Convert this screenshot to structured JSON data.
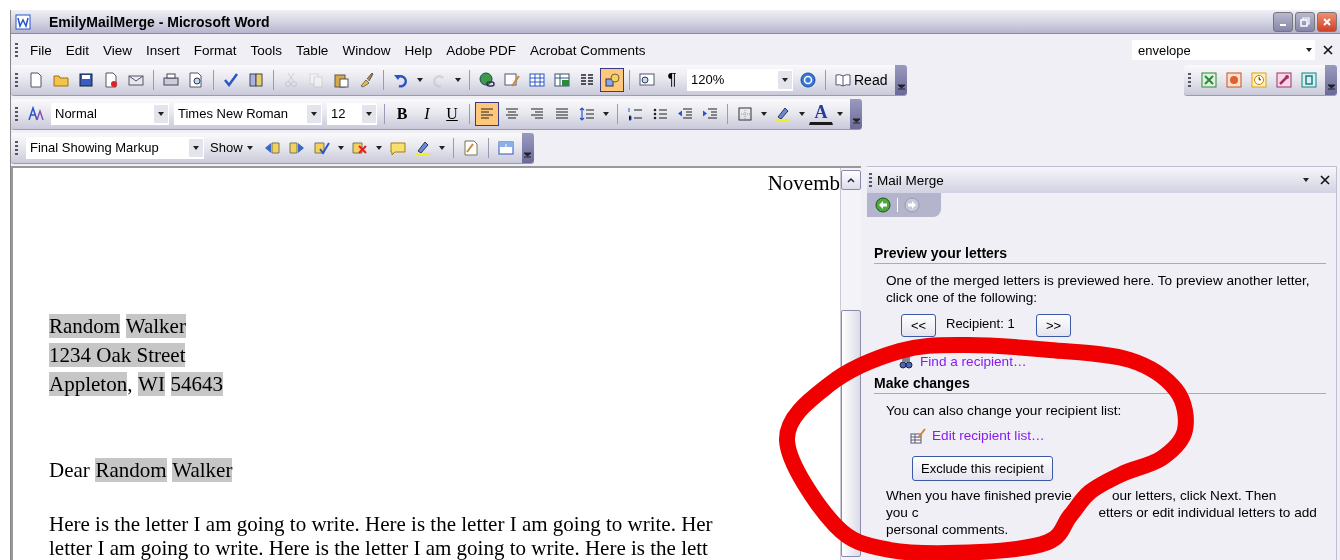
{
  "window": {
    "title": "EmilyMailMerge - Microsoft Word"
  },
  "menu_bar": {
    "items": [
      "File",
      "Edit",
      "View",
      "Insert",
      "Format",
      "Tools",
      "Table",
      "Window",
      "Help",
      "Adobe PDF",
      "Acrobat Comments"
    ],
    "help_box": {
      "value": "envelope"
    }
  },
  "standard_toolbar": {
    "drawing_on": true,
    "show_marks_label": "¶",
    "zoom": "120%",
    "read_label": "Read"
  },
  "formatting_toolbar": {
    "style": "Normal",
    "font": "Times New Roman",
    "size": "12",
    "text_buttons": [
      {
        "label": "B",
        "kind": "bold",
        "selected": false
      },
      {
        "label": "I",
        "kind": "italic",
        "selected": false
      },
      {
        "label": "U",
        "kind": "underline",
        "selected": false
      }
    ],
    "alignment": [
      {
        "selected": true
      },
      {
        "selected": false
      },
      {
        "selected": false
      },
      {
        "selected": false
      }
    ],
    "font_color_label": "A"
  },
  "reviewing_toolbar": {
    "display": "Final Showing Markup",
    "show_label": "Show"
  },
  "document": {
    "date": "Novemb",
    "address": [
      [
        {
          "text": "Random",
          "field": true
        },
        {
          "text": "Walker",
          "field": true
        }
      ],
      [
        {
          "text": "1234 Oak Street",
          "field": true
        }
      ],
      [
        {
          "text": "Appleton",
          "field": true
        },
        {
          "text": ",",
          "field": false
        },
        {
          "text": "WI",
          "field": true
        },
        {
          "text": "54643",
          "field": true
        }
      ]
    ],
    "greeting": [
      {
        "text": "Dear",
        "field": false
      },
      {
        "text": "Random",
        "field": true
      },
      {
        "text": "Walker",
        "field": true
      }
    ],
    "body": [
      "Here is the letter I am going to write. Here is the letter I am going to write. Her",
      "letter I am going to write. Here is the letter I am going to write. Here is the lett"
    ]
  },
  "task_pane": {
    "title": "Mail Merge",
    "back_enabled": true,
    "forward_enabled": false,
    "preview": {
      "heading": "Preview your letters",
      "text": "One of the merged letters is previewed here. To preview another letter, click one of the following:",
      "prev_label": "<<",
      "recipient": "Recipient: 1",
      "next_label": ">>",
      "find_link": "Find a recipient…"
    },
    "changes": {
      "heading": "Make changes",
      "text": "You can also change your recipient list:",
      "edit_link": "Edit recipient list…",
      "exclude_button": "Exclude this recipient",
      "note_lines": [
        [
          "When you have finished previe",
          "our letters, click Next. Then"
        ],
        [
          "you c",
          "etters or edit individual letters to add"
        ],
        [
          "personal comments."
        ]
      ]
    }
  }
}
